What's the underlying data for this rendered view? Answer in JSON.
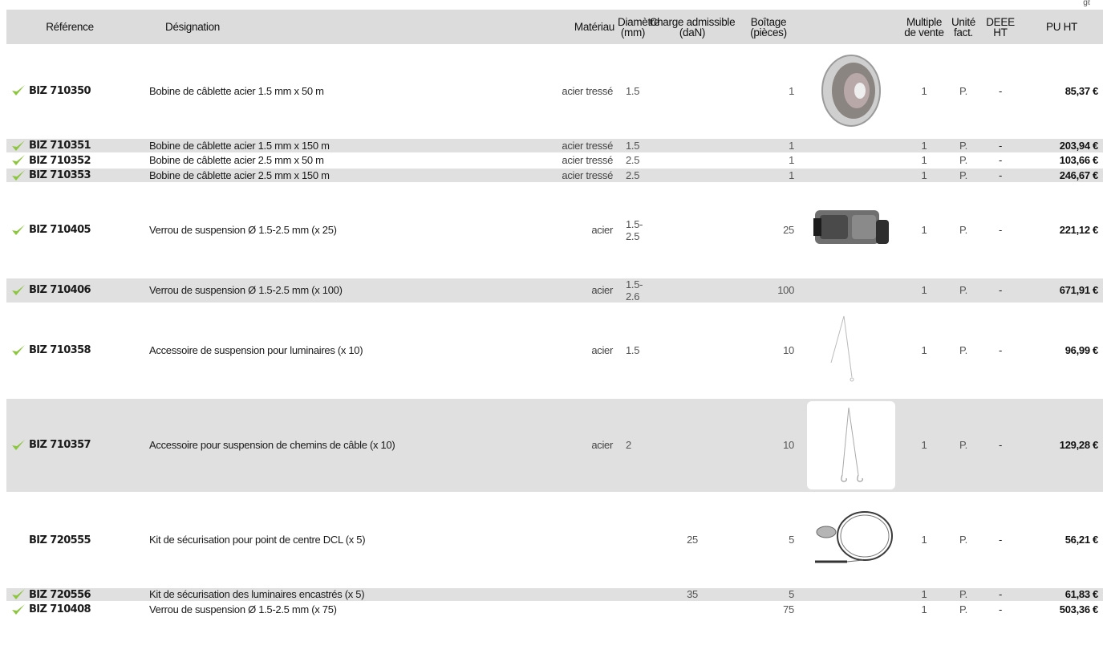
{
  "corner_mark": "gℓ",
  "header": {
    "reference": "Référence",
    "designation": "Désignation",
    "materiau": "Matériau",
    "diametre": "Diamètre (mm)",
    "charge": "Charge admissible (daN)",
    "boitage": "Boîtage (pièces)",
    "multiple": "Multiple de vente",
    "unite": "Unité fact.",
    "deee": "DEEE HT",
    "price": "PU HT"
  },
  "rows": [
    {
      "ref": "BIZ 710350",
      "designation": "Bobine de câblette acier 1.5 mm x 50 m",
      "materiau": "acier tressé",
      "diametre": "1.5",
      "charge": "",
      "boitage": "1",
      "image": "wire-spool-image",
      "multiple": "1",
      "unite": "P.",
      "deee": "-",
      "price": "85,37 €",
      "check": true
    },
    {
      "ref": "BIZ 710351",
      "designation": "Bobine de câblette acier 1.5 mm x 150 m",
      "materiau": "acier tressé",
      "diametre": "1.5",
      "charge": "",
      "boitage": "1",
      "multiple": "1",
      "unite": "P.",
      "deee": "-",
      "price": "203,94 €",
      "check": true
    },
    {
      "ref": "BIZ 710352",
      "designation": "Bobine de câblette acier 2.5 mm x 50 m",
      "materiau": "acier tressé",
      "diametre": "2.5",
      "charge": "",
      "boitage": "1",
      "multiple": "1",
      "unite": "P.",
      "deee": "-",
      "price": "103,66 €",
      "check": true
    },
    {
      "ref": "BIZ 710353",
      "designation": "Bobine de câblette acier 2.5 mm x 150 m",
      "materiau": "acier tressé",
      "diametre": "2.5",
      "charge": "",
      "boitage": "1",
      "multiple": "1",
      "unite": "P.",
      "deee": "-",
      "price": "246,67 €",
      "check": true
    },
    {
      "ref": "BIZ 710405",
      "designation": "Verrou de suspension Ø 1.5-2.5 mm (x 25)",
      "materiau": "acier",
      "diametre": "1.5-2.5",
      "charge": "",
      "boitage": "25",
      "image": "suspension-lock-image",
      "multiple": "1",
      "unite": "P.",
      "deee": "-",
      "price": "221,12 €",
      "check": true
    },
    {
      "ref": "BIZ 710406",
      "designation": "Verrou de suspension Ø 1.5-2.5 mm (x 100)",
      "materiau": "acier",
      "diametre": "1.5-2.6",
      "charge": "",
      "boitage": "100",
      "multiple": "1",
      "unite": "P.",
      "deee": "-",
      "price": "671,91 €",
      "check": true
    },
    {
      "ref": "BIZ 710358",
      "designation": "Accessoire de suspension pour luminaires (x 10)",
      "materiau": "acier",
      "diametre": "1.5",
      "charge": "",
      "boitage": "10",
      "image": "luminaire-suspension-image",
      "multiple": "1",
      "unite": "P.",
      "deee": "-",
      "price": "96,99 €",
      "check": true
    },
    {
      "ref": "BIZ 710357",
      "designation": "Accessoire pour suspension de chemins de câble (x 10)",
      "materiau": "acier",
      "diametre": "2",
      "charge": "",
      "boitage": "10",
      "image": "cable-tray-suspension-image",
      "multiple": "1",
      "unite": "P.",
      "deee": "-",
      "price": "129,28 €",
      "check": true
    },
    {
      "ref": "BIZ 720555",
      "designation": "Kit de sécurisation pour point de centre DCL (x 5)",
      "materiau": "",
      "diametre": "",
      "charge": "25",
      "boitage": "5",
      "image": "dcl-safety-kit-image",
      "multiple": "1",
      "unite": "P.",
      "deee": "-",
      "price": "56,21 €",
      "check": false
    },
    {
      "ref": "BIZ 720556",
      "designation": "Kit de sécurisation des luminaires encastrés (x 5)",
      "materiau": "",
      "diametre": "",
      "charge": "35",
      "boitage": "5",
      "multiple": "1",
      "unite": "P.",
      "deee": "-",
      "price": "61,83 €",
      "check": true
    },
    {
      "ref": "BIZ 710408",
      "designation": "Verrou de suspension Ø 1.5-2.5 mm (x 75)",
      "materiau": "",
      "diametre": "",
      "charge": "",
      "boitage": "75",
      "multiple": "1",
      "unite": "P.",
      "deee": "-",
      "price": "503,36 €",
      "check": true
    }
  ],
  "colors": {
    "row_grey": "#e0e0e0",
    "check_green": "#8cc63f",
    "header_bg": "#dcdcdc"
  }
}
